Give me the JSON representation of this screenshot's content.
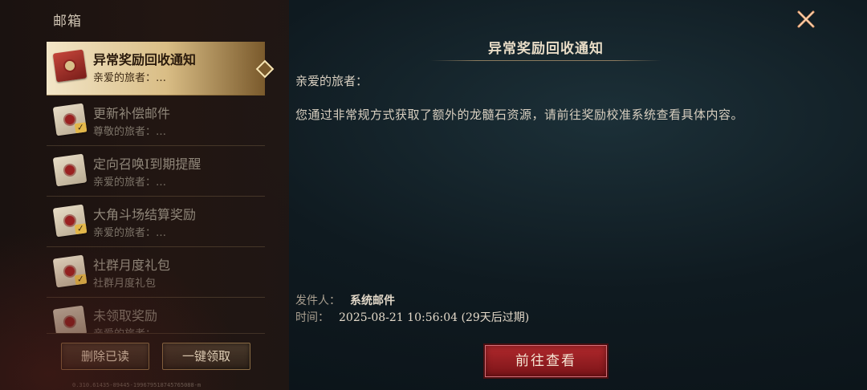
{
  "mailbox": {
    "title": "邮箱",
    "mails": [
      {
        "title": "异常奖励回收通知",
        "subtitle": "亲爱的旅者：…",
        "selected": true,
        "claimed": false
      },
      {
        "title": "更新补偿邮件",
        "subtitle": "尊敬的旅者：…",
        "selected": false,
        "claimed": true
      },
      {
        "title": "定向召唤Ⅰ到期提醒",
        "subtitle": "亲爱的旅者：…",
        "selected": false,
        "claimed": false
      },
      {
        "title": "大角斗场结算奖励",
        "subtitle": "亲爱的旅者：…",
        "selected": false,
        "claimed": true
      },
      {
        "title": "社群月度礼包",
        "subtitle": "社群月度礼包",
        "selected": false,
        "claimed": true
      },
      {
        "title": "未领取奖励",
        "subtitle": "亲爱的旅者：…",
        "selected": false,
        "claimed": false
      }
    ],
    "delete_read_label": "删除已读",
    "claim_all_label": "一键领取",
    "version": "0.310.61435-89445-199679518745765088-m"
  },
  "detail": {
    "title": "异常奖励回收通知",
    "greeting": "亲爱的旅者：",
    "body": "您通过非常规方式获取了额外的龙髓石资源，请前往奖励校准系统查看具体内容。",
    "sender_label": "发件人：",
    "sender": "系统邮件",
    "time_label": "时间：",
    "time": "2025-08-21 10:56:04 (29天后过期)",
    "action_label": "前往查看"
  },
  "icons": {
    "close": "close-x-icon",
    "envelope": "envelope-icon",
    "claimed": "checkmark-icon"
  },
  "colors": {
    "accent_red": "#b0282c",
    "gold": "#d9bd85"
  }
}
